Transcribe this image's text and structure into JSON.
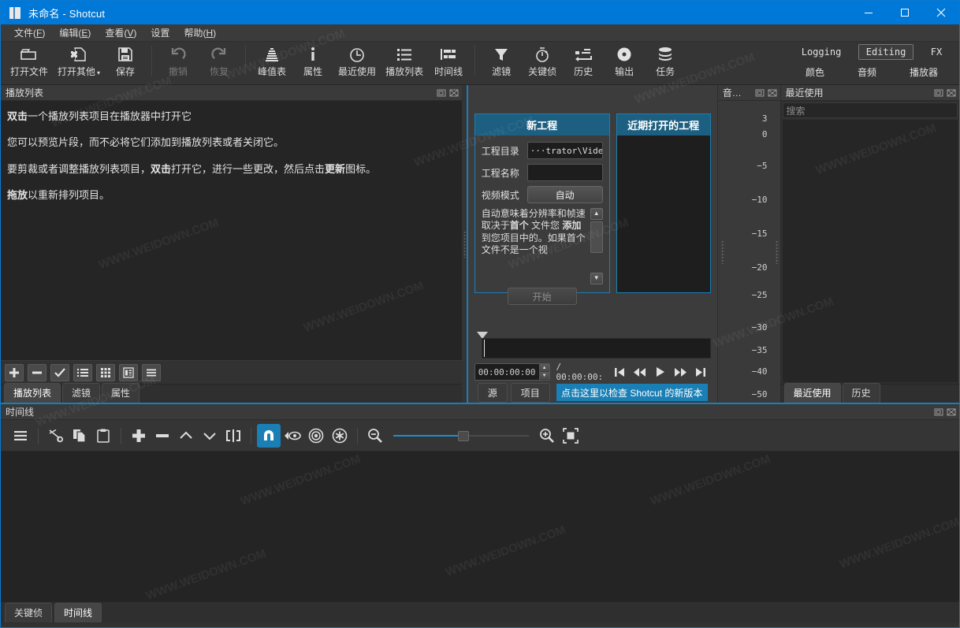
{
  "window": {
    "title": "未命名 - Shotcut",
    "minimize": "−",
    "maximize": "□",
    "close": "✕"
  },
  "menubar": [
    {
      "label": "文件",
      "accel": "F"
    },
    {
      "label": "编辑",
      "accel": "E"
    },
    {
      "label": "查看",
      "accel": "V"
    },
    {
      "label": "设置",
      "accel": ""
    },
    {
      "label": "帮助",
      "accel": "H"
    }
  ],
  "toolbar": {
    "items": [
      {
        "label": "打开文件",
        "icon": "open-file-icon",
        "disabled": false,
        "caret": false
      },
      {
        "label": "打开其他",
        "icon": "open-other-icon",
        "disabled": false,
        "caret": true
      },
      {
        "label": "保存",
        "icon": "save-icon",
        "disabled": false,
        "caret": false
      },
      {
        "label": "撤销",
        "icon": "undo-icon",
        "disabled": true,
        "caret": false
      },
      {
        "label": "恢复",
        "icon": "redo-icon",
        "disabled": true,
        "caret": false
      },
      {
        "label": "峰值表",
        "icon": "peak-meter-icon",
        "disabled": false,
        "caret": false
      },
      {
        "label": "属性",
        "icon": "properties-icon",
        "disabled": false,
        "caret": false
      },
      {
        "label": "最近使用",
        "icon": "recent-clock-icon",
        "disabled": false,
        "caret": false
      },
      {
        "label": "播放列表",
        "icon": "playlist-icon",
        "disabled": false,
        "caret": false
      },
      {
        "label": "时间线",
        "icon": "timeline-icon",
        "disabled": false,
        "caret": false
      },
      {
        "label": "滤镜",
        "icon": "filter-funnel-icon",
        "disabled": false,
        "caret": false
      },
      {
        "label": "关键侦",
        "icon": "keyframes-stopwatch-icon",
        "disabled": false,
        "caret": false
      },
      {
        "label": "历史",
        "icon": "history-icon",
        "disabled": false,
        "caret": false
      },
      {
        "label": "输出",
        "icon": "export-disc-icon",
        "disabled": false,
        "caret": false
      },
      {
        "label": "任务",
        "icon": "jobs-stack-icon",
        "disabled": false,
        "caret": false
      }
    ],
    "layouts_row1": [
      {
        "label": "Logging",
        "selected": false
      },
      {
        "label": "Editing",
        "selected": true
      },
      {
        "label": "FX",
        "selected": false
      }
    ],
    "layouts_row2": [
      {
        "label": "颜色"
      },
      {
        "label": "音频"
      },
      {
        "label": "播放器"
      }
    ]
  },
  "playlist": {
    "title": "播放列表",
    "hints": [
      {
        "bold": "双击",
        "rest": "一个播放列表项目在播放器中打开它"
      },
      {
        "bold": "",
        "rest": "您可以预览片段，而不必将它们添加到播放列表或者关闭它。"
      },
      {
        "bold": "",
        "rest": "要剪裁或者调整播放列表项目，双击打开它，进行一些更改，然后点击更新图标。"
      },
      {
        "bold": "拖放",
        "rest": "以重新排列项目。"
      }
    ],
    "hint3_parts": {
      "p1": "要剪裁或者调整播放列表项目，",
      "b1": "双击",
      "p2": "打开它，进行一些更改，然后点击",
      "b2": "更新",
      "p3": "图标。"
    },
    "toolbar_buttons": [
      {
        "name": "add",
        "icon": "plus-icon"
      },
      {
        "name": "remove",
        "icon": "minus-icon"
      },
      {
        "name": "update",
        "icon": "check-icon"
      },
      {
        "name": "view-detail",
        "icon": "list-icon"
      },
      {
        "name": "view-tiles",
        "icon": "grid-icon"
      },
      {
        "name": "view-icons",
        "icon": "icons-view-icon"
      },
      {
        "name": "menu",
        "icon": "hamburger-icon"
      }
    ],
    "tabs": [
      {
        "label": "播放列表",
        "active": true
      },
      {
        "label": "滤镜",
        "active": false
      },
      {
        "label": "属性",
        "active": false
      }
    ]
  },
  "new_project": {
    "card_title": "新工程",
    "recent_title": "近期打开的工程",
    "fields": [
      {
        "label": "工程目录",
        "value": "···trator\\Videos",
        "type": "text"
      },
      {
        "label": "工程名称",
        "value": "",
        "type": "text"
      },
      {
        "label": "视频模式",
        "value": "自动",
        "type": "button"
      }
    ],
    "description_parts": {
      "a": "自动意味着分辨率和帧速取决于",
      "b": "首个",
      "c": " 文件您 ",
      "d": "添加",
      "e": " 到您项目中的。如果首个文件不是一个视"
    },
    "start_button": "开始"
  },
  "player": {
    "current_time": "00:00:00:00",
    "separator": "/",
    "total_time": "00:00:00:",
    "buttons": [
      {
        "name": "skip-previous",
        "icon": "skip-start-icon"
      },
      {
        "name": "rewind",
        "icon": "rewind-icon"
      },
      {
        "name": "play",
        "icon": "play-icon"
      },
      {
        "name": "fast-forward",
        "icon": "fast-forward-icon"
      },
      {
        "name": "skip-next",
        "icon": "skip-end-icon"
      },
      {
        "name": "more",
        "icon": "chevron-double-right-icon"
      }
    ],
    "source_tab": "源",
    "project_tab": "项目",
    "update_banner": "点击这里以检查 Shotcut 的新版本"
  },
  "audio_meter": {
    "title": "音…",
    "ticks": [
      "3",
      "0",
      "−5",
      "−10",
      "−15",
      "−20",
      "−25",
      "−30",
      "−35",
      "−40",
      "−50"
    ]
  },
  "recent": {
    "title": "最近使用",
    "search_placeholder": "搜索",
    "tabs": [
      {
        "label": "最近使用",
        "active": true
      },
      {
        "label": "历史",
        "active": false
      }
    ]
  },
  "timeline": {
    "title": "时间线",
    "buttons": [
      {
        "name": "timeline-menu",
        "icon": "hamburger-icon",
        "on": false
      },
      {
        "name": "cut",
        "icon": "scissors-icon",
        "on": false
      },
      {
        "name": "copy",
        "icon": "copy-icon",
        "on": false
      },
      {
        "name": "paste",
        "icon": "clipboard-icon",
        "on": false
      },
      {
        "name": "append",
        "icon": "plus-icon",
        "on": false
      },
      {
        "name": "ripple-delete",
        "icon": "minus-icon",
        "on": false
      },
      {
        "name": "lift",
        "icon": "chevron-up-icon",
        "on": false
      },
      {
        "name": "overwrite",
        "icon": "chevron-down-icon",
        "on": false
      },
      {
        "name": "split",
        "icon": "split-icon",
        "on": false
      },
      {
        "name": "snap",
        "icon": "magnet-icon",
        "on": true
      },
      {
        "name": "scrub-while-dragging",
        "icon": "eye-scrub-icon",
        "on": false
      },
      {
        "name": "ripple",
        "icon": "ripple-target-icon",
        "on": false
      },
      {
        "name": "ripple-all-tracks",
        "icon": "ripple-all-icon",
        "on": false
      },
      {
        "name": "zoom-out",
        "icon": "zoom-out-icon",
        "on": false
      },
      {
        "name": "zoom-in",
        "icon": "zoom-in-icon",
        "on": false
      },
      {
        "name": "zoom-fit",
        "icon": "zoom-fit-icon",
        "on": false
      }
    ],
    "zoom_value": 50,
    "tabs": [
      {
        "label": "关键侦",
        "active": false
      },
      {
        "label": "时间线",
        "active": true
      }
    ]
  },
  "colors": {
    "accent": "#1a7fb5",
    "titlebar": "#0078d7",
    "panel_bg": "#3c3c3c",
    "dark_bg": "#252525",
    "text": "#dcdcdc"
  },
  "watermark": "WWW.WEIDOWN.COM"
}
